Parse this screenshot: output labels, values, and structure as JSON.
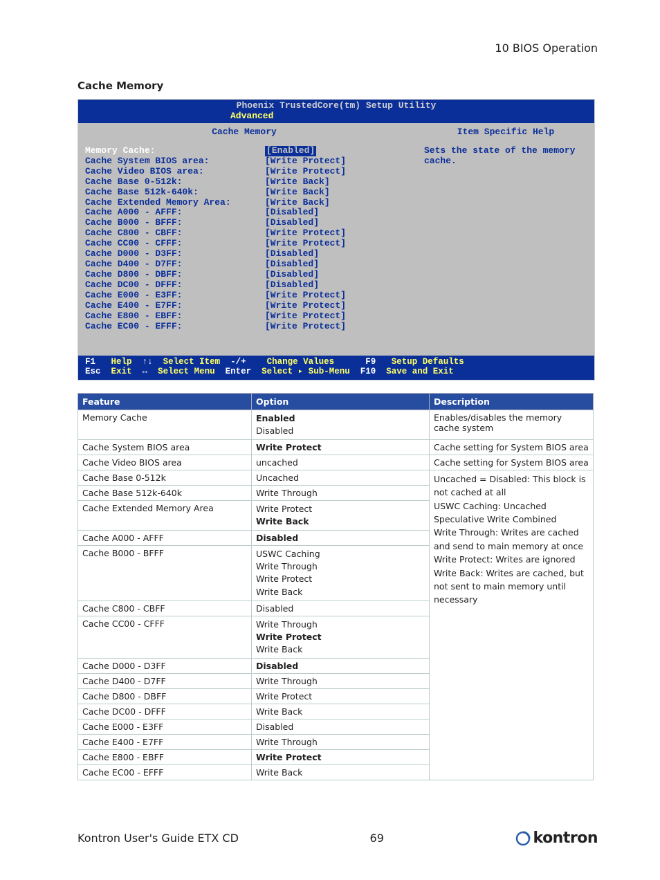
{
  "chapter": "10 BIOS Operation",
  "section": "Cache Memory",
  "bios": {
    "top": "Phoenix TrustedCore(tm) Setup Utility",
    "tab": "Advanced",
    "title": "Cache Memory",
    "help_title": "Item Specific Help",
    "help_body": "Sets the state of the memory cache.",
    "rows": [
      {
        "k": "Memory Cache:",
        "v": "[Enabled]",
        "white": true,
        "inv": true
      },
      {
        "k": "Cache System BIOS area:",
        "v": "[Write Protect]"
      },
      {
        "k": "Cache Video BIOS area:",
        "v": "[Write Protect]"
      },
      {
        "k": "Cache Base 0-512k:",
        "v": "[Write Back]"
      },
      {
        "k": "Cache Base 512k-640k:",
        "v": "[Write Back]"
      },
      {
        "k": "Cache Extended Memory Area:",
        "v": "[Write Back]"
      },
      {
        "k": "Cache A000 - AFFF:",
        "v": "[Disabled]"
      },
      {
        "k": "Cache B000 - BFFF:",
        "v": "[Disabled]"
      },
      {
        "k": "Cache C800 - CBFF:",
        "v": "[Write Protect]"
      },
      {
        "k": "Cache CC00 - CFFF:",
        "v": "[Write Protect]"
      },
      {
        "k": "Cache D000 - D3FF:",
        "v": "[Disabled]"
      },
      {
        "k": "Cache D400 - D7FF:",
        "v": "[Disabled]"
      },
      {
        "k": "Cache D800 - DBFF:",
        "v": "[Disabled]"
      },
      {
        "k": "Cache DC00 - DFFF:",
        "v": "[Disabled]"
      },
      {
        "k": "Cache E000 - E3FF:",
        "v": "[Write Protect]"
      },
      {
        "k": "Cache E400 - E7FF:",
        "v": "[Write Protect]"
      },
      {
        "k": "Cache E800 - EBFF:",
        "v": "[Write Protect]"
      },
      {
        "k": "Cache EC00 - EFFF:",
        "v": "[Write Protect]"
      }
    ],
    "bottom1": {
      "f1": "F1",
      "help": "Help",
      "ud": "↑↓",
      "si": "Select Item",
      "pm": "-/+",
      "cv": "Change Values",
      "f9": "F9",
      "sd": "Setup Defaults"
    },
    "bottom2": {
      "esc": "Esc",
      "exit": "Exit",
      "lr": "↔",
      "sm": "Select Menu",
      "enter": "Enter",
      "ssm": "Select ▸ Sub-Menu",
      "f10": "F10",
      "se": "Save and Exit"
    }
  },
  "table": {
    "h1": "Feature",
    "h2": "Option",
    "h3": "Description",
    "r1f": "Memory Cache",
    "r1o": "Enabled\nDisabled",
    "r1ob": "Enabled",
    "r1d": "Enables/disables the memory cache system",
    "r2f": "Cache System BIOS area",
    "r2o": "Write Protect",
    "r2d": "Cache setting for System BIOS area",
    "r3f": "Cache Video BIOS area",
    "r3o": "uncached",
    "r3d": "Cache setting for System BIOS area",
    "r4f": "Cache Base 0-512k",
    "r4o": "Uncached",
    "r5f": "Cache Base 512k-640k",
    "r5o1": "Write Through",
    "r6f": "Cache Extended Memory Area",
    "r6o1": "Write Protect",
    "r6o2": "Write Back",
    "r7f": "Cache A000 - AFFF",
    "r7o": "Disabled",
    "r8f": "Cache B000 - BFFF",
    "r8o": "USWC Caching\nWrite Through\nWrite Protect\nWrite Back",
    "r9f": "Cache C800 - CBFF",
    "r9o": "Disabled",
    "r10f": "Cache CC00 - CFFF",
    "r10o1": "Write Through",
    "r10o2": "Write Protect",
    "r10o3": "Write Back",
    "r11f": "Cache D000 - D3FF",
    "r11o": "Disabled",
    "r12f": "Cache D400 - D7FF",
    "r12o": "Write Through",
    "r13f": "Cache D800 - DBFF",
    "r13o": "Write Protect",
    "r14f": "Cache DC00 - DFFF",
    "r14o": "Write Back",
    "r15f": "Cache E000 - E3FF",
    "r15o": "Disabled",
    "r16f": "Cache E400 - E7FF",
    "r16o": "Write Through",
    "r17f": "Cache E800 - EBFF",
    "r17o": "Write Protect",
    "r18f": "Cache EC00 - EFFF",
    "r18o": "Write Back",
    "desc_big": "Uncached = Disabled: This block is not cached at all\nUSWC Caching: Uncached Speculative Write Combined\nWrite Through: Writes are cached and send to main memory at once\nWrite Protect: Writes are ignored\nWrite Back: Writes are cached, but not sent to main memory until necessary"
  },
  "footer": {
    "left": "Kontron User's Guide ETX CD",
    "page": "69",
    "brand": "kontron"
  }
}
